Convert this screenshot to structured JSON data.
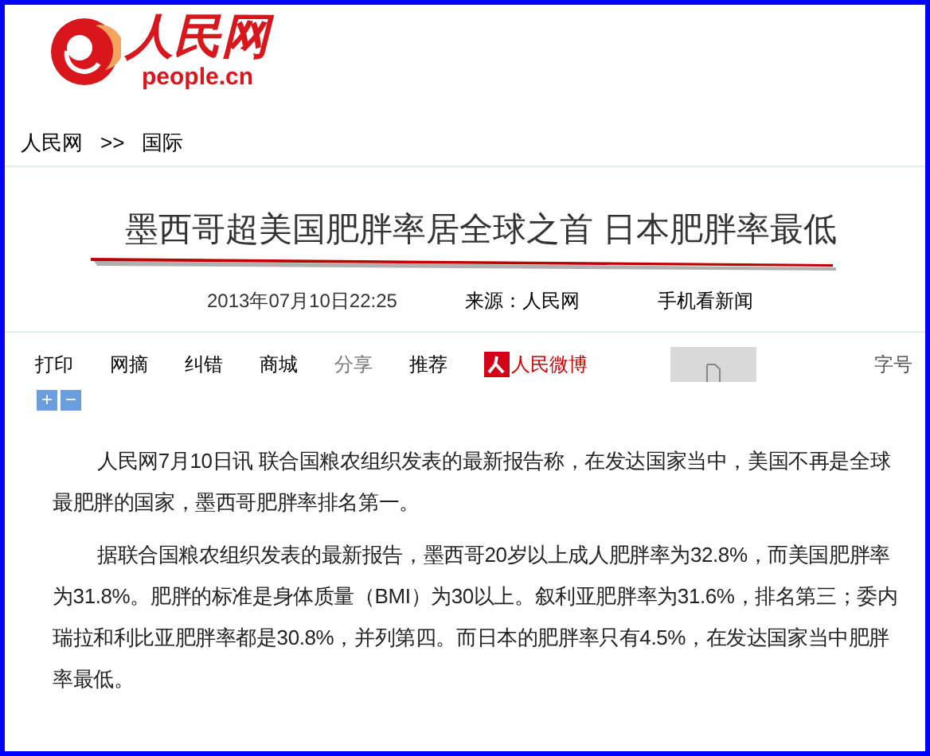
{
  "logo": {
    "name": "人民网",
    "domain": "people.cn"
  },
  "breadcrumb": [
    {
      "label": "人民网"
    },
    {
      "label": ">>"
    },
    {
      "label": "国际"
    }
  ],
  "article": {
    "title": "墨西哥超美国肥胖率居全球之首 日本肥胖率最低",
    "date": "2013年07月10日22:25",
    "source": "来源：人民网",
    "mobile_link": "手机看新闻"
  },
  "toolbar": [
    {
      "kind": "link",
      "label": "打印",
      "disabled": false
    },
    {
      "kind": "link",
      "label": "网摘",
      "disabled": false
    },
    {
      "kind": "link",
      "label": "纠错",
      "disabled": false
    },
    {
      "kind": "link",
      "label": "商城",
      "disabled": false
    },
    {
      "kind": "link",
      "label": "分享",
      "disabled": true
    },
    {
      "kind": "link",
      "label": "推荐",
      "disabled": false
    },
    {
      "kind": "weibo",
      "label": "人民微博",
      "disabled": false
    },
    {
      "kind": "image"
    }
  ],
  "font_size": {
    "label": "字号",
    "increase": "+",
    "decrease": "−"
  },
  "paragraphs": [
    "人民网7月10日讯 联合国粮农组织发表的最新报告称，在发达国家当中，美国不再是全球最肥胖的国家，墨西哥肥胖率排名第一。",
    "据联合国粮农组织发表的最新报告，墨西哥20岁以上成人肥胖率为32.8%，而美国肥胖率为31.8%。肥胖的标准是身体质量（BMI）为30以上。叙利亚肥胖率为31.6%，排名第三；委内瑞拉和利比亚肥胖率都是30.8%，并列第四。而日本的肥胖率只有4.5%，在发达国家当中肥胖率最低。"
  ]
}
